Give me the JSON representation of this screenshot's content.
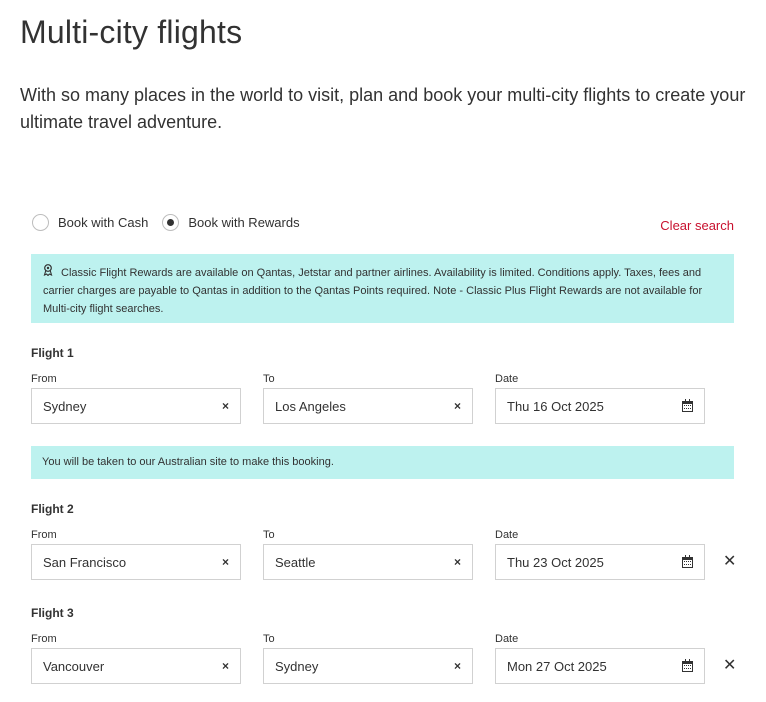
{
  "page": {
    "title": "Multi-city flights",
    "intro": "With so many places in the world to visit, plan and book your multi-city flights to create your ultimate travel adventure."
  },
  "booking_type": {
    "options": [
      {
        "label": "Book with Cash",
        "selected": false
      },
      {
        "label": "Book with Rewards",
        "selected": true
      }
    ],
    "clear_search": "Clear search"
  },
  "rewards_notice": {
    "icon": "award-ribbon-icon",
    "text": "Classic Flight Rewards are available on Qantas, Jetstar and partner airlines. Availability is limited. Conditions apply. Taxes, fees and carrier charges are payable to Qantas in addition to the Qantas Points required. Note - Classic Plus Flight Rewards are not available for Multi-city flight searches."
  },
  "site_notice": "You will be taken to our Australian site to make this booking.",
  "labels": {
    "from": "From",
    "to": "To",
    "date": "Date",
    "clear": "×",
    "remove": "✕"
  },
  "flights": [
    {
      "title": "Flight 1",
      "from": "Sydney",
      "to": "Los Angeles",
      "date": "Thu 16 Oct 2025",
      "removable": false
    },
    {
      "title": "Flight 2",
      "from": "San Francisco",
      "to": "Seattle",
      "date": "Thu 23 Oct 2025",
      "removable": true
    },
    {
      "title": "Flight 3",
      "from": "Vancouver",
      "to": "Sydney",
      "date": "Mon 27 Oct 2025",
      "removable": true
    }
  ],
  "colors": {
    "accent": "#c8102e",
    "notice_bg": "#bdf2ef",
    "text": "#323232"
  }
}
